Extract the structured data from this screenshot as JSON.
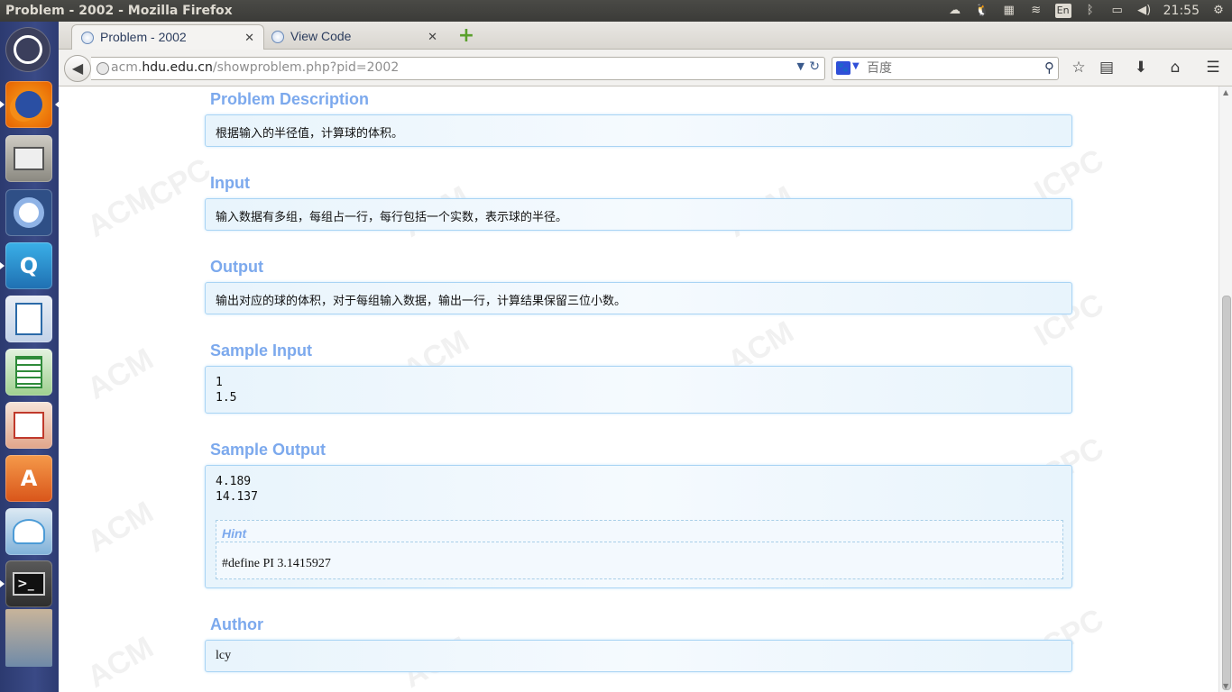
{
  "window": {
    "title": "Problem - 2002 - Mozilla Firefox"
  },
  "system_tray": {
    "keyboard_layout": "En",
    "clock": "21:55"
  },
  "launcher": {
    "items": [
      {
        "name": "ubuntu-dash-icon",
        "color": "#3b3f5c"
      },
      {
        "name": "firefox-icon",
        "color": "#e66000"
      },
      {
        "name": "files-icon",
        "color": "#8a8880"
      },
      {
        "name": "chromium-icon",
        "color": "#3f6fb5"
      },
      {
        "name": "qq-icon",
        "color": "#1f8fd1"
      },
      {
        "name": "writer-icon",
        "color": "#2b6aa8"
      },
      {
        "name": "calc-icon",
        "color": "#2f8b3a"
      },
      {
        "name": "impress-icon",
        "color": "#c0392b"
      },
      {
        "name": "software-center-icon",
        "color": "#e8742a"
      },
      {
        "name": "update-manager-icon",
        "color": "#4c9bd6"
      },
      {
        "name": "terminal-icon",
        "color": "#2d2d2d"
      },
      {
        "name": "workspace-switcher-icon",
        "color": "#8b6b4a"
      }
    ]
  },
  "tabs": [
    {
      "label": "Problem - 2002",
      "close": "✕"
    },
    {
      "label": "View Code",
      "close": "✕"
    }
  ],
  "navbar": {
    "url_prefix": "acm.",
    "url_host": "hdu.edu.cn",
    "url_path": "/showproblem.php?pid=2002",
    "search_placeholder": "百度"
  },
  "problem": {
    "description": {
      "title": "Problem Description",
      "text": "根据输入的半径值，计算球的体积。"
    },
    "input": {
      "title": "Input",
      "text": "输入数据有多组，每组占一行，每行包括一个实数，表示球的半径。"
    },
    "output": {
      "title": "Output",
      "text": "输出对应的球的体积，对于每组输入数据，输出一行，计算结果保留三位小数。"
    },
    "sample_input": {
      "title": "Sample Input",
      "text": "1\n1.5"
    },
    "sample_output": {
      "title": "Sample Output",
      "text": "4.189\n14.137"
    },
    "hint": {
      "title": "Hint",
      "text": "#define PI 3.1415927"
    },
    "author": {
      "title": "Author",
      "text": "lcy"
    }
  },
  "watermark": {
    "words": [
      "ACM",
      "ICPC"
    ]
  }
}
